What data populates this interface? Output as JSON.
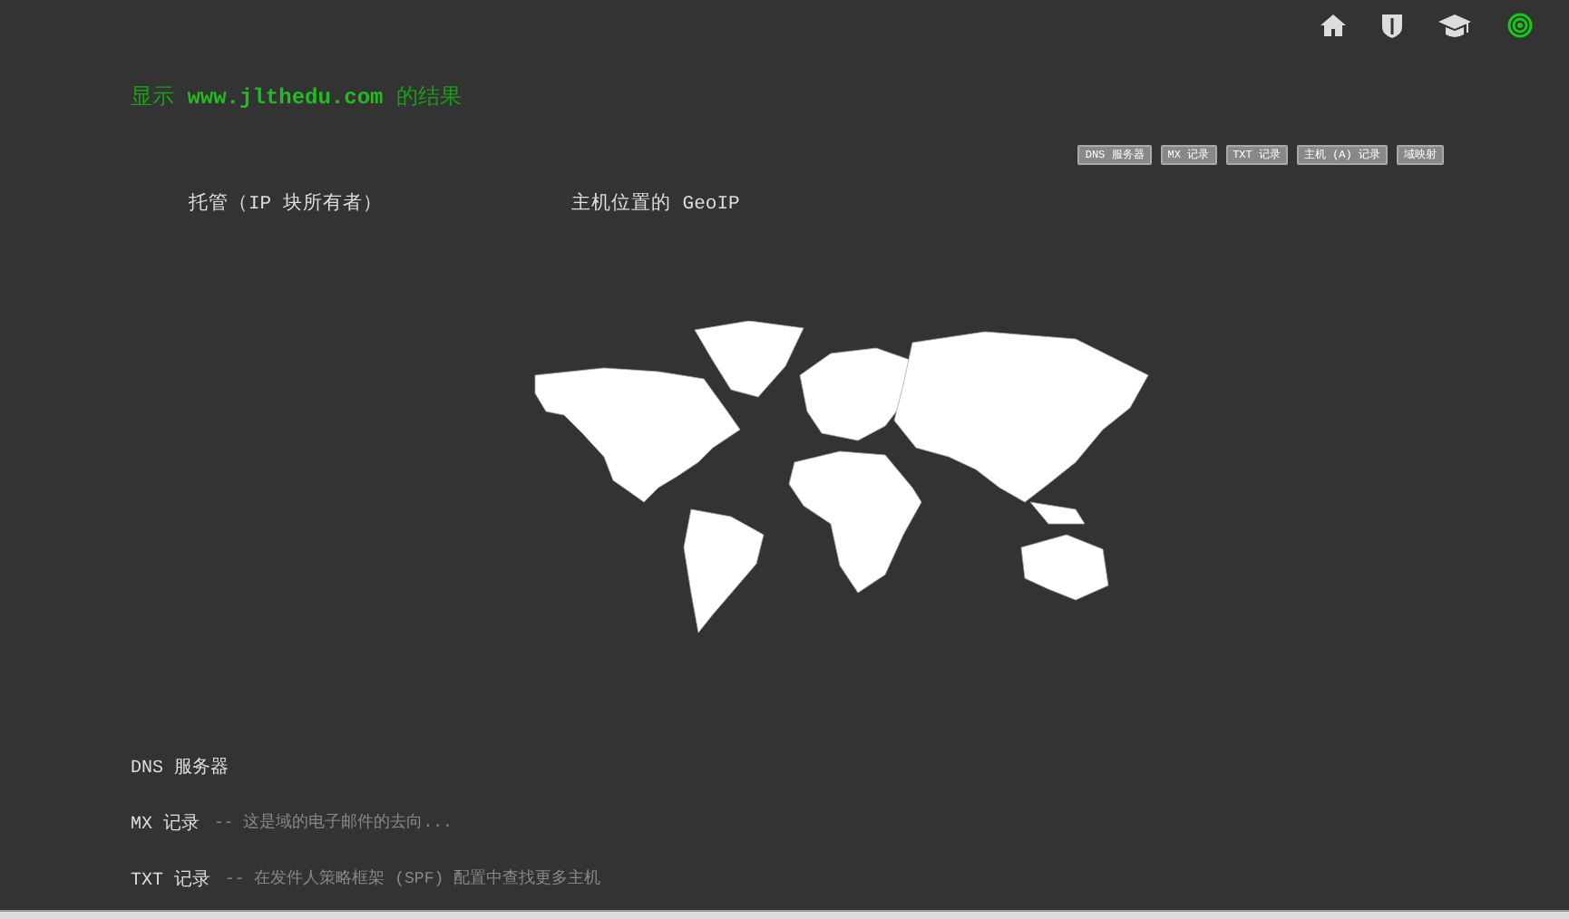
{
  "title": "显示 **www.jlthedu.com** 的结果",
  "record_buttons": [
    "DNS 服务器",
    "MX 记录",
    "TXT 记录",
    "主机 (A) 记录",
    "域映射"
  ],
  "panels": [
    {
      "heading": "托管（IP 块所有者）"
    },
    {
      "heading": "主机位置的 GeoIP",
      "kind": "map"
    }
  ],
  "sections": [
    {
      "heading": "DNS 服务器"
    },
    {
      "heading": "MX 记录",
      "note": "-- 这是域的电子邮件的去向..."
    },
    {
      "heading": "TXT 记录",
      "note": "-- 在发件人策略框架 (SPF) 配置中查找更多主机"
    }
  ]
}
